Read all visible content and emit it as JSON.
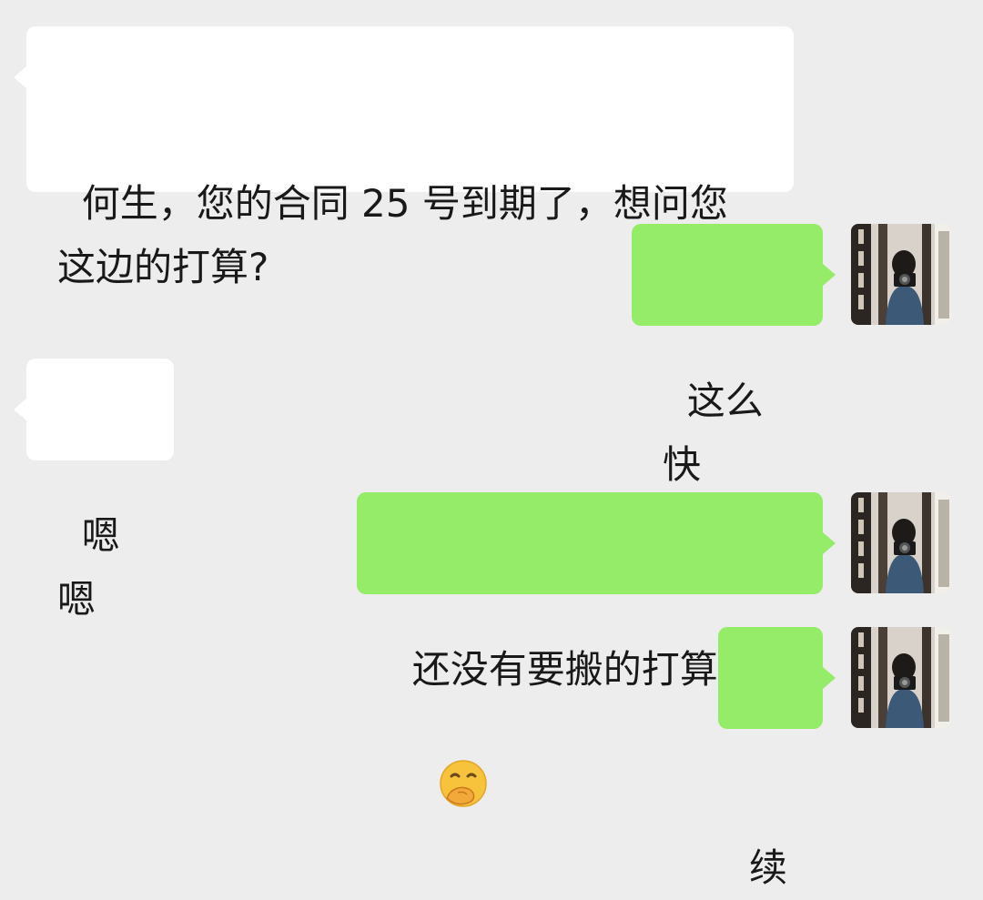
{
  "messages": [
    {
      "side": "in",
      "text": "何生，您的合同 25 号到期了，想问您\n这边的打算?"
    },
    {
      "side": "out",
      "text": "这么快"
    },
    {
      "side": "in",
      "text": "嗯嗯"
    },
    {
      "side": "out",
      "text": "还没有要搬的打算",
      "emoji": "thinking-hand-over-mouth-emoji"
    },
    {
      "side": "out",
      "text": "续"
    }
  ],
  "colors": {
    "background": "#ededed",
    "incoming_bubble": "#ffffff",
    "outgoing_bubble": "#95ec69",
    "text": "#191919"
  },
  "avatar": {
    "icon": "self-portrait-photo-avatar"
  }
}
